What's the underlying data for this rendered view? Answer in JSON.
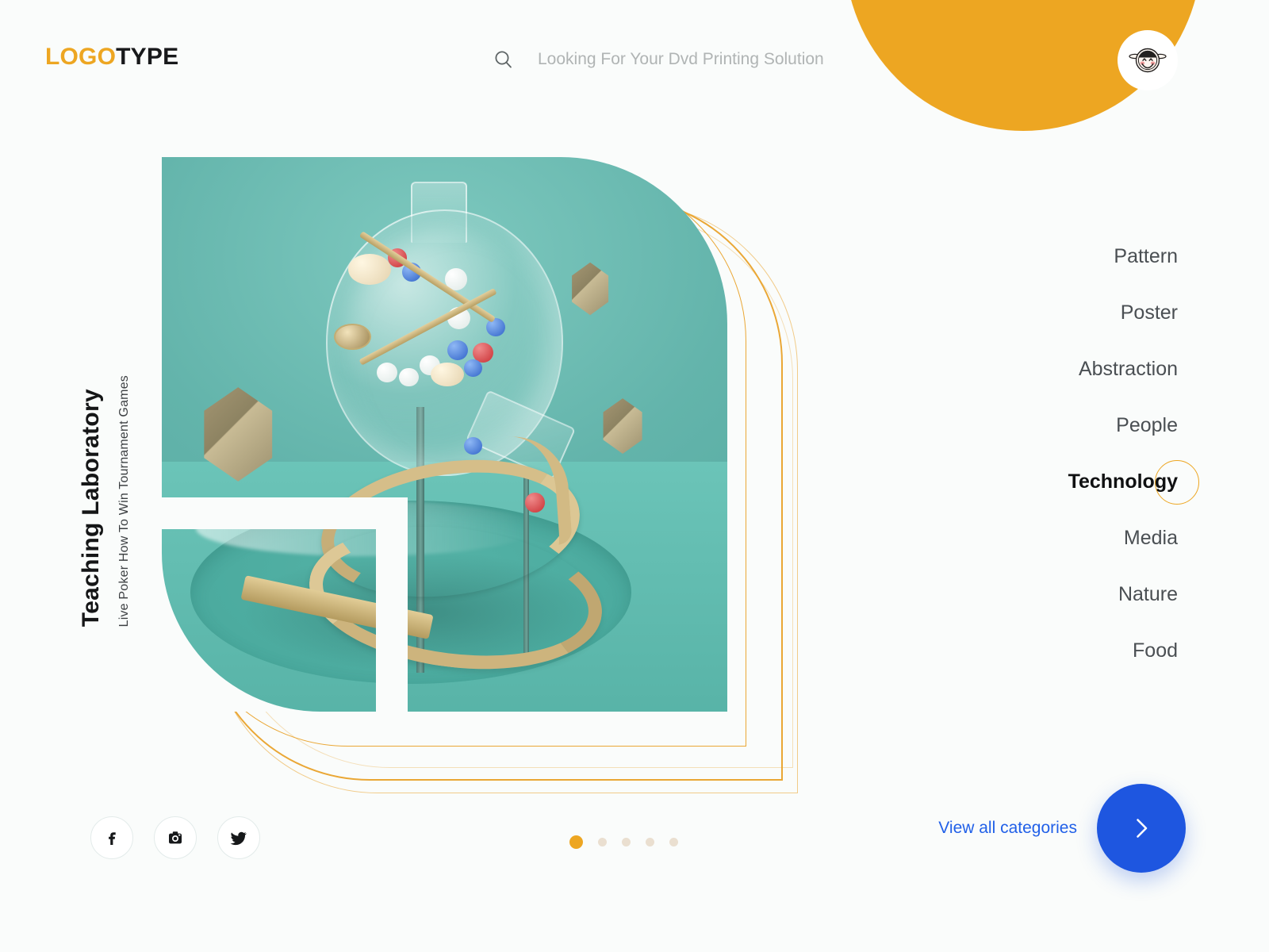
{
  "brand": {
    "logo_first": "LOGO",
    "logo_second": "TYPE",
    "accent_orange": "#eda622",
    "accent_blue": "#1e56e0",
    "background": "#fafcfb"
  },
  "header": {
    "search": {
      "icon": "search-icon",
      "placeholder": "Looking For Your Dvd Printing Solution",
      "value": ""
    },
    "avatar": {
      "icon": "user-avatar-face-icon",
      "alt": "User avatar"
    }
  },
  "hero": {
    "title": "Teaching Laboratory",
    "subtitle": "Live Poker How To Win Tournament Games",
    "image_alt": "3D render of a glass laboratory flask with colored spheres above a golden spiral ramp on a teal stage"
  },
  "categories": {
    "items": [
      {
        "label": "Pattern",
        "active": false
      },
      {
        "label": "Poster",
        "active": false
      },
      {
        "label": "Abstraction",
        "active": false
      },
      {
        "label": "People",
        "active": false
      },
      {
        "label": "Technology",
        "active": true
      },
      {
        "label": "Media",
        "active": false
      },
      {
        "label": "Nature",
        "active": false
      },
      {
        "label": "Food",
        "active": false
      }
    ]
  },
  "footer": {
    "socials": [
      {
        "name": "facebook-icon",
        "glyph": "f"
      },
      {
        "name": "instagram-icon",
        "glyph": ""
      },
      {
        "name": "twitter-icon",
        "glyph": ""
      }
    ],
    "carousel": {
      "total": 5,
      "active_index": 1
    },
    "view_all_label": "View all categories",
    "next_button": {
      "icon": "chevron-right-icon",
      "label": "Next"
    }
  }
}
